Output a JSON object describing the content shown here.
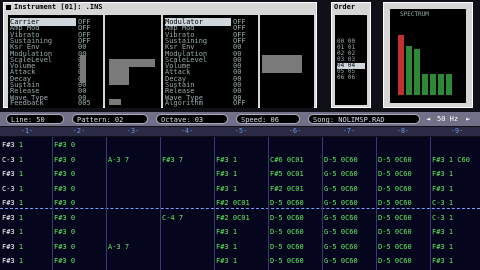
{
  "instrument_window": {
    "title": "Instrument [01]: .INS",
    "params_left": [
      "Carrier",
      "Amp Mod",
      "Vibrato",
      "Sustaining",
      "Ksr Env",
      "Modulation",
      "ScaleLevel",
      "Volume",
      "Attack",
      "Decay",
      "Sustain",
      "Release",
      "Wave Type"
    ],
    "values_left": [
      "OFF",
      "OFF",
      "OFF",
      "OFF",
      "00",
      "00",
      "00",
      "00",
      "00",
      "00",
      "00",
      "00",
      "00"
    ],
    "params_right": [
      "Modulator",
      "Amp Mod",
      "Vibrato",
      "Sustaining",
      "Ksr Env",
      "Modulation",
      "ScaleLevel",
      "Volume",
      "Attack",
      "Decay",
      "Sustain",
      "Release",
      "Wave Type"
    ],
    "values_right": [
      "OFF",
      "OFF",
      "OFF",
      "OFF",
      "00",
      "00",
      "00",
      "00",
      "00",
      "00",
      "00",
      "00",
      "00"
    ],
    "feedback_label": "Feedback",
    "feedback_value": "005",
    "algorithm_label": "Algorithm",
    "algorithm_value": "OFF"
  },
  "order_window": {
    "title": "Order",
    "rows": [
      "00",
      "01",
      "02",
      "03",
      "04",
      "05",
      "06"
    ],
    "selected_index": 4
  },
  "spectrum_window": {
    "label": "SPECTRUM",
    "levels": [
      0.85,
      0.7,
      0.65,
      0.3,
      0.3,
      0.3,
      0.3
    ]
  },
  "status_bar": {
    "line": "Line: 50",
    "pattern": "Pattern: 02",
    "octave": "Octave: 03",
    "speed": "Speed: 06",
    "song": "Song: NOLIMSP.RAD",
    "refresh": "50 Hz"
  },
  "channels": [
    "-1-",
    "-2-",
    "-3-",
    "-4-",
    "-5-",
    "-6-",
    "-7-",
    "-8-",
    "-9-"
  ],
  "pattern_rows": [
    {
      "cells": [
        "F#3 1",
        "F#3 0",
        "",
        "",
        "",
        "",
        "",
        "",
        ""
      ]
    },
    {
      "cells": [
        "C-3 1",
        "F#3 0",
        "A-3 7",
        "F#3 7",
        "F#3 1",
        "C#6 0C01",
        "D-5 0C60",
        "D-5 0C60",
        "F#3 1 C60"
      ]
    },
    {
      "cells": [
        "F#3 1",
        "F#3 0",
        "",
        "",
        "F#3 1",
        "F#5 0C01",
        "G-5 0C60",
        "D-5 0C60",
        "F#3 1"
      ]
    },
    {
      "cells": [
        "C-3 1",
        "F#3 0",
        "",
        "",
        "F#3 1",
        "F#2 0C01",
        "G-5 0C60",
        "D-5 0C60",
        "F#3 1"
      ]
    },
    {
      "cells": [
        "F#3 1",
        "F#3 0",
        "",
        "",
        "F#2 0C01",
        "D-5 0C60",
        "G-5 0C60",
        "D-5 0C60",
        "C-3 1"
      ]
    },
    {
      "cells": [
        "F#3 1",
        "F#3 0",
        "",
        "C-4 7",
        "F#2 0C01",
        "D-5 0C60",
        "G-5 0C60",
        "D-5 0C60",
        "C-3 1"
      ]
    },
    {
      "cells": [
        "F#3 1",
        "F#3 0",
        "",
        "",
        "F#3 1",
        "D-5 0C60",
        "G-5 0C60",
        "D-5 0C60",
        "F#3 1"
      ]
    },
    {
      "cells": [
        "F#3 1",
        "F#3 0",
        "A-3 7",
        "",
        "F#3 1",
        "D-5 0C60",
        "G-5 0C60",
        "D-5 0C60",
        "F#3 1"
      ]
    },
    {
      "cells": [
        "F#3 1",
        "F#3 0",
        "",
        "",
        "F#3 1",
        "D-5 0C60",
        "G-5 0C60",
        "D-5 0C60",
        "F#3 1"
      ]
    }
  ]
}
